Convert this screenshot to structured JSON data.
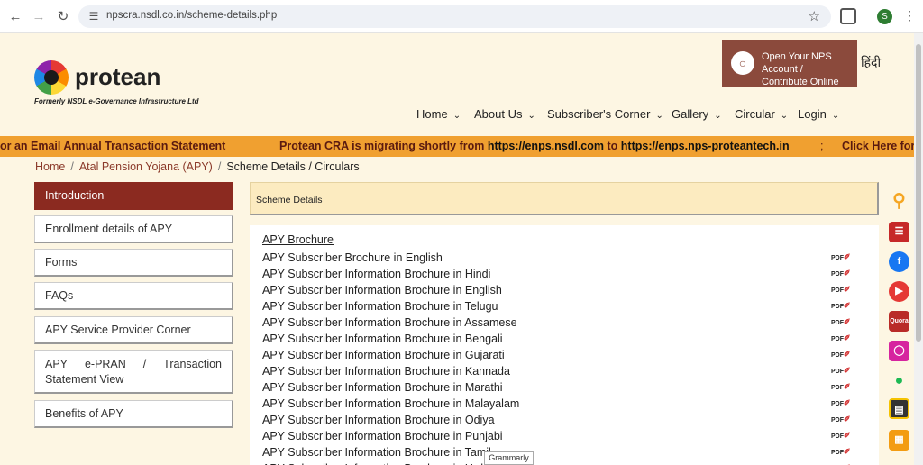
{
  "browser": {
    "url": "npscra.nsdl.co.in/scheme-details.php",
    "profile_initial": "S"
  },
  "header": {
    "brand": "protean",
    "tagline": "Formerly NSDL e-Governance Infrastructure Ltd",
    "open_account_line1": "Open Your NPS Account /",
    "open_account_line2": "Contribute Online",
    "language": "हिंदी"
  },
  "menu": [
    "Home",
    "About Us",
    "Subscriber's Corner",
    "Gallery",
    "Circular",
    "Login"
  ],
  "ticker": {
    "item1": "or an Email Annual Transaction Statement",
    "item2_prefix": "Protean CRA is migrating shortly from ",
    "item2_url1": "https://enps.nsdl.com",
    "item2_mid": " to ",
    "item2_url2": "https://enps.nps-proteantech.in",
    "separator": ";",
    "item3": "Click Here for"
  },
  "breadcrumb": {
    "home": "Home",
    "section": "Atal Pension Yojana (APY)",
    "current": "Scheme Details / Circulars",
    "separator": "/"
  },
  "sidebar": {
    "items": [
      {
        "label": "Introduction"
      },
      {
        "label": "Enrollment details of APY"
      },
      {
        "label": "Forms"
      },
      {
        "label": "FAQs"
      },
      {
        "label": "APY Service Provider Corner"
      },
      {
        "label_parts": [
          "APY",
          "e-PRAN",
          "/",
          "Transaction"
        ],
        "label_line2": "Statement View"
      },
      {
        "label": "Benefits of APY"
      }
    ]
  },
  "main": {
    "section_title": "Scheme Details",
    "doc_heading": "APY Brochure",
    "pdf_label": "PDF",
    "docs": [
      "APY Subscriber Brochure in English",
      "APY Subscriber Information Brochure in Hindi",
      "APY Subscriber Information Brochure in English",
      "APY Subscriber Information Brochure in Telugu",
      "APY Subscriber Information Brochure in Assamese",
      "APY Subscriber Information Brochure in Bengali",
      "APY Subscriber Information Brochure in Gujarati",
      "APY Subscriber Information Brochure in Kannada",
      "APY Subscriber Information Brochure in Marathi",
      "APY Subscriber Information Brochure in Malayalam",
      "APY Subscriber Information Brochure in Odiya",
      "APY Subscriber Information Brochure in Punjabi",
      "APY Subscriber Information Brochure in Tamil",
      "APY Subscriber Information Brochure in Urdu"
    ]
  },
  "tooltip": "Grammarly",
  "social": {
    "quora": "Quora",
    "colors": {
      "search": "#f5a623",
      "chat": "#c62828",
      "facebook": "#1877f2",
      "youtube": "#e53935",
      "quora": "#b92b27",
      "instagram": "#d6249f",
      "spotify": "#1db954",
      "book": "#333333",
      "orange": "#f39c12"
    }
  },
  "colors": {
    "accent": "#8b2a20",
    "ticker_bg": "#f0a030",
    "page_bg": "#fdf6e3"
  }
}
